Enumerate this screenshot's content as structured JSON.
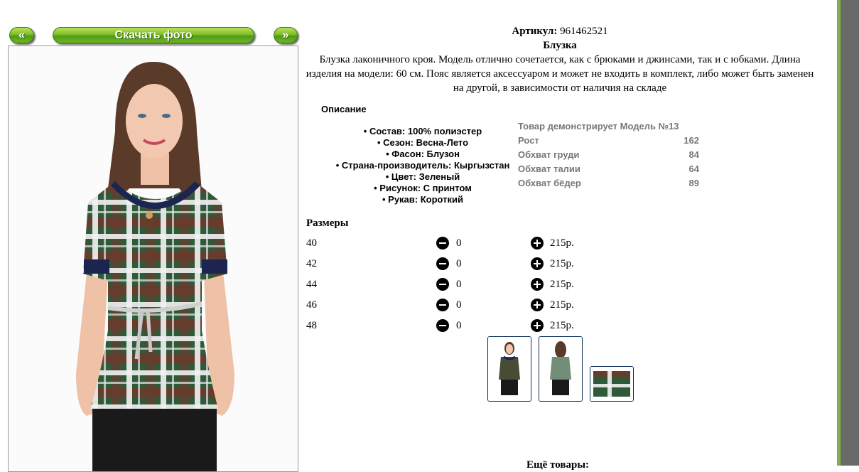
{
  "nav": {
    "prev_label": "«",
    "download_label": "Скачать фото",
    "next_label": "»"
  },
  "product": {
    "article_label": "Артикул:",
    "article_value": "961462521",
    "name": "Блузка",
    "description": "Блузка лаконичного кроя. Модель отлично сочетается, как с брюками и джинсами, так и с юбками. Длина изделия на модели: 60 см. Пояс является аксессуаром и может не входить в комплект, либо может быть заменен на другой, в зависимости от наличия на складе"
  },
  "description_title": "Описание",
  "features": [
    "• Состав: 100% полиэстер",
    "• Сезон: Весна-Лето",
    "• Фасон: Блузон",
    "• Страна-производитель: Кыргызстан",
    "• Цвет: Зеленый",
    "• Рисунок: С принтом",
    "• Рукав: Короткий"
  ],
  "model": {
    "title": "Товар демонстрирует Модель №13",
    "rows": [
      {
        "label": "Рост",
        "value": "162"
      },
      {
        "label": "Обхват груди",
        "value": "84"
      },
      {
        "label": "Обхват талии",
        "value": "64"
      },
      {
        "label": "Обхват бёдер",
        "value": "89"
      }
    ]
  },
  "sizes_title": "Размеры",
  "sizes": [
    {
      "size": "40",
      "qty": "0",
      "price": "215р."
    },
    {
      "size": "42",
      "qty": "0",
      "price": "215р."
    },
    {
      "size": "44",
      "qty": "0",
      "price": "215р."
    },
    {
      "size": "46",
      "qty": "0",
      "price": "215р."
    },
    {
      "size": "48",
      "qty": "0",
      "price": "215р."
    }
  ],
  "more_title": "Ещё товары:",
  "colors": {
    "accent_green": "#6fb526",
    "thumb_border": "#0a2b55",
    "sidebar_gray": "#6a6a6a"
  }
}
